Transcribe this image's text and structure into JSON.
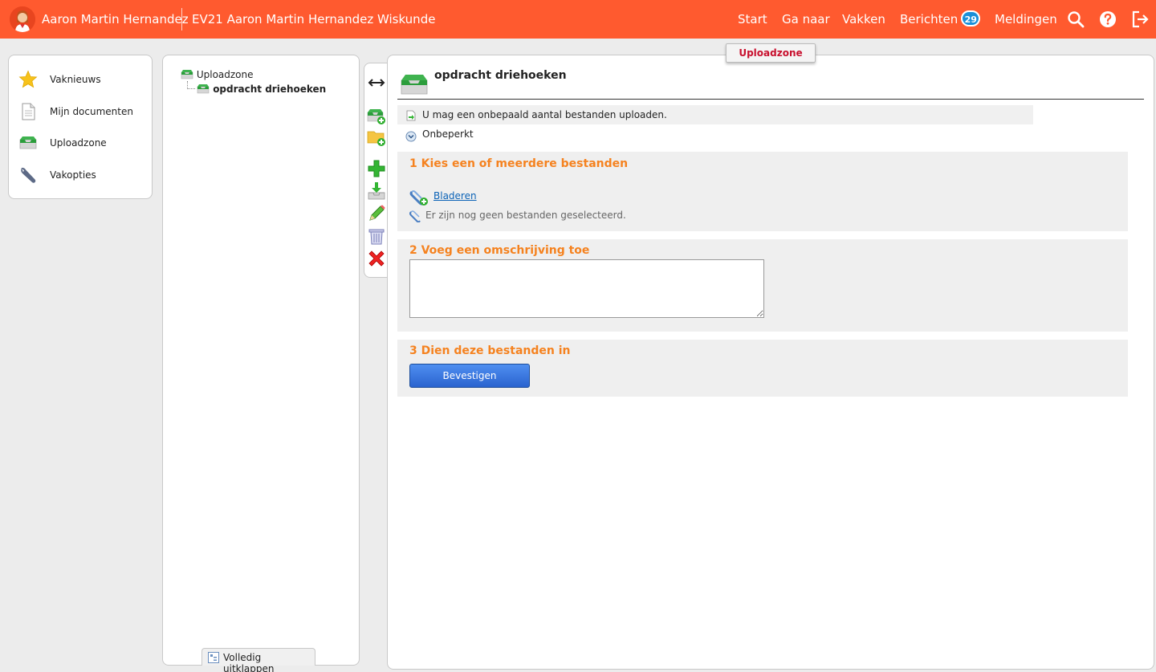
{
  "topbar": {
    "user_name": "Aaron Martin Hernandez",
    "course_title": "EV21 Aaron Martin Hernandez Wiskunde",
    "nav": {
      "start": "Start",
      "goto": "Ga naar",
      "courses": "Vakken",
      "messages": "Berichten",
      "messages_count": "29",
      "notifications": "Meldingen"
    },
    "icons": [
      "search-icon",
      "help-icon",
      "logout-icon"
    ],
    "color": "#ff5a2f"
  },
  "leftnav": {
    "items": [
      {
        "label": "Vaknieuws",
        "icon": "star-icon"
      },
      {
        "label": "Mijn documenten",
        "icon": "document-icon"
      },
      {
        "label": "Uploadzone",
        "icon": "inbox-icon"
      },
      {
        "label": "Vakopties",
        "icon": "wrench-icon"
      }
    ]
  },
  "tree": {
    "root": "Uploadzone",
    "child": "opdracht driehoeken",
    "expand_label": "Volledig uitklappen"
  },
  "toolbar": {
    "icons": [
      "resize-icon",
      "add-uploadzone-icon",
      "add-folder-icon",
      "add-icon",
      "download-icon",
      "edit-icon",
      "trash-icon",
      "delete-icon"
    ]
  },
  "main": {
    "tab_label": "Uploadzone",
    "title": "opdracht driehoeken",
    "info_text": "U mag een onbepaald aantal bestanden uploaden.",
    "limit_text": "Onbeperkt",
    "step1_title": "1 Kies een of meerdere bestanden",
    "browse_label": "Bladeren ",
    "no_files_text": "Er zijn nog geen bestanden geselecteerd.",
    "step2_title": "2 Voeg een omschrijving toe",
    "description_value": "",
    "step3_title": "3 Dien deze bestanden in",
    "submit_label": "Bevestigen",
    "accent_color": "#f5821f"
  }
}
